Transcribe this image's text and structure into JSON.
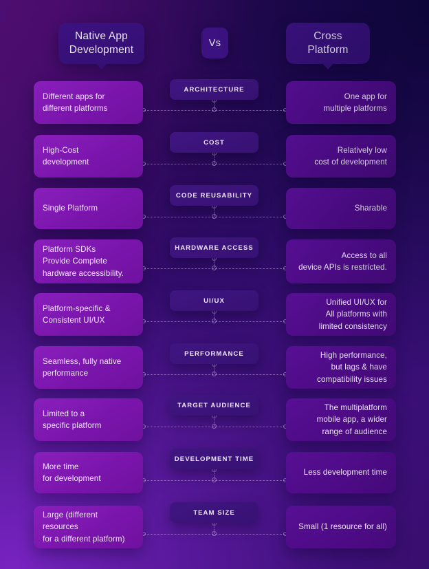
{
  "header": {
    "left_title": "Native App\nDevelopment",
    "left_line1": "Native App",
    "left_line2": "Development",
    "vs_label": "Vs",
    "right_line1": "Cross",
    "right_line2": "Platform"
  },
  "colors": {
    "left_card": "#7b18ad",
    "right_card": "#4d0b85",
    "pill": "#3a1277",
    "header_pill": "#3b1280",
    "text": "#efe9f9",
    "connector": "#cdaaeb",
    "bg_top_left": "#3d085c",
    "bg_top_right": "#1b0a4a",
    "bg_bottom_left": "#5a1a9e",
    "bg_bottom_right": "#3a0e6e"
  },
  "rows": [
    {
      "label": "ARCHITECTURE",
      "left": "Different apps for\ndifferent  platforms",
      "left_lines": [
        "Different apps for",
        "different  platforms"
      ],
      "right": "One app for\nmultiple  platforms",
      "right_lines": [
        "One app for",
        "multiple  platforms"
      ]
    },
    {
      "label": "COST",
      "left": "High-Cost\ndevelopment",
      "left_lines": [
        "High-Cost",
        "development"
      ],
      "right": "Relatively low\ncost of development",
      "right_lines": [
        "Relatively low",
        "cost of development"
      ]
    },
    {
      "label": "CODE REUSABILITY",
      "left": "Single Platform",
      "left_lines": [
        "Single Platform"
      ],
      "right": "Sharable",
      "right_lines": [
        "Sharable"
      ]
    },
    {
      "label": "HARDWARE ACCESS",
      "left": "Platform SDKs\nProvide Complete\nhardware accessibility.",
      "left_lines": [
        "Platform SDKs",
        "Provide Complete",
        "hardware accessibility."
      ],
      "right": "Access to all\ndevice APIs is restricted.",
      "right_lines": [
        "Access to all",
        "device APIs is restricted."
      ]
    },
    {
      "label": "UI/UX",
      "left": "Platform-specific &\nConsistent UI/UX",
      "left_lines": [
        "Platform-specific &",
        "Consistent UI/UX"
      ],
      "right": "Unified UI/UX for\nAll platforms with\nlimited consistency",
      "right_lines": [
        "Unified UI/UX for",
        "All platforms with",
        "limited consistency"
      ]
    },
    {
      "label": "PERFORMANCE",
      "left": "Seamless, fully native\nperformance",
      "left_lines": [
        "Seamless, fully native",
        "performance"
      ],
      "right": "High performance,\nbut lags & have\ncompatibility issues",
      "right_lines": [
        "High performance,",
        "but lags & have",
        "compatibility issues"
      ]
    },
    {
      "label": "TARGET AUDIENCE",
      "left": "Limited to a\nspecific  platform",
      "left_lines": [
        "Limited to a",
        "specific  platform"
      ],
      "right": "The multiplatform\nmobile app, a wider\nrange of audience",
      "right_lines": [
        "The multiplatform",
        "mobile app, a wider",
        "range of audience"
      ]
    },
    {
      "label": "DEVELOPMENT TIME",
      "left": "More time\nfor development",
      "left_lines": [
        "More time",
        "for development"
      ],
      "right": "Less development time",
      "right_lines": [
        "Less development time"
      ]
    },
    {
      "label": "TEAM SIZE",
      "left": "Large (different resources\nfor a different platform)",
      "left_lines": [
        "Large (different resources",
        "for a different platform)"
      ],
      "right": "Small (1 resource for all)",
      "right_lines": [
        "Small (1 resource for all)"
      ]
    }
  ]
}
